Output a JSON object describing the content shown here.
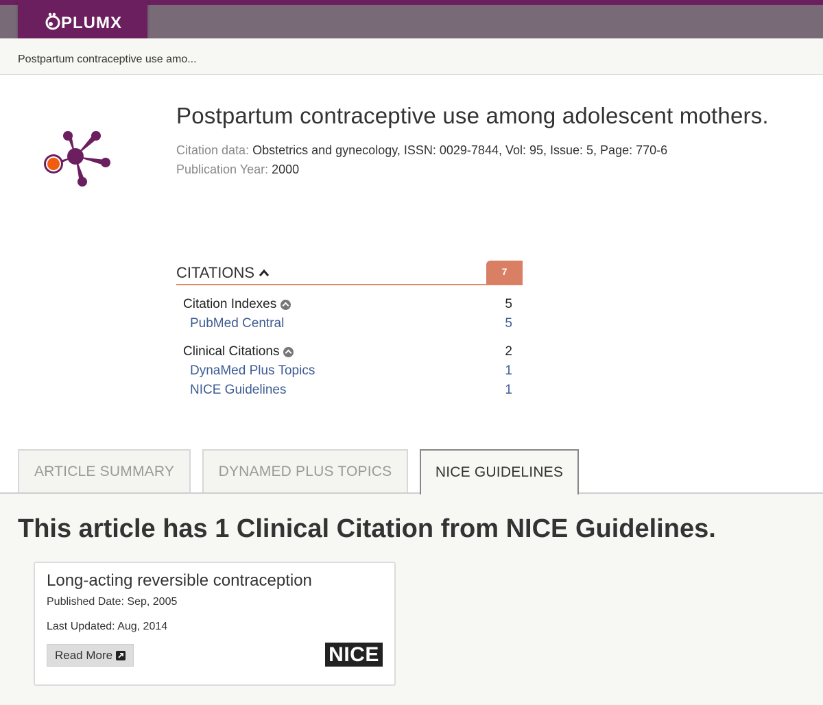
{
  "brand": {
    "name": "PLUMX",
    "color": "#6b1f5e"
  },
  "breadcrumb": "Postpartum contraceptive use amo...",
  "article": {
    "title": "Postpartum contraceptive use among adolescent mothers.",
    "citation_label": "Citation data:",
    "citation_value": "Obstetrics and gynecology, ISSN: 0029-7844, Vol: 95, Issue: 5, Page: 770-6",
    "year_label": "Publication Year:",
    "year_value": "2000"
  },
  "citations": {
    "label": "CITATIONS",
    "total": "7",
    "groups": [
      {
        "name": "Citation Indexes",
        "count": "5",
        "sources": [
          {
            "name": "PubMed Central",
            "count": "5"
          }
        ]
      },
      {
        "name": "Clinical Citations",
        "count": "2",
        "sources": [
          {
            "name": "DynaMed Plus Topics",
            "count": "1"
          },
          {
            "name": "NICE Guidelines",
            "count": "1"
          }
        ]
      }
    ]
  },
  "tabs": [
    {
      "label": "ARTICLE SUMMARY",
      "active": false
    },
    {
      "label": "DYNAMED PLUS TOPICS",
      "active": false
    },
    {
      "label": "NICE GUIDELINES",
      "active": true
    }
  ],
  "panel": {
    "heading": "This article has 1 Clinical Citation from NICE Guidelines.",
    "card": {
      "title": "Long-acting reversible contraception",
      "published": "Published Date: Sep, 2005",
      "updated": "Last Updated: Aug, 2014",
      "button": "Read More",
      "logo": "NICE"
    }
  },
  "icons": {
    "artifact": "plumx-artifact-icon",
    "collapse": "chevron-up-icon",
    "group_toggle": "circle-chevron-up-icon",
    "external": "external-link-icon"
  }
}
